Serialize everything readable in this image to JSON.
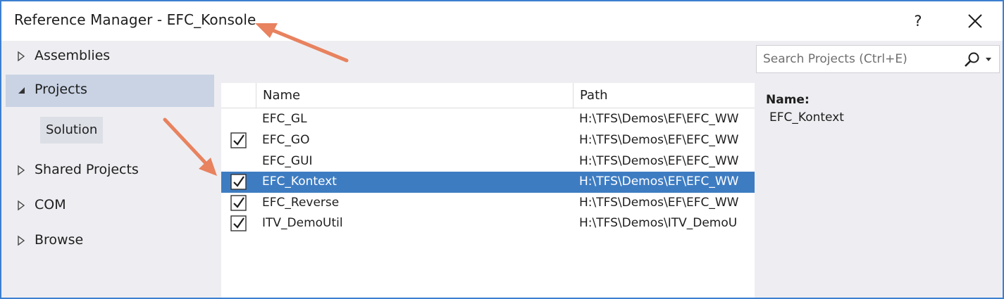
{
  "window": {
    "title": "Reference Manager - EFC_Konsole",
    "help_label": "?",
    "close_icon": "close-icon",
    "border_color": "#3c7fd0"
  },
  "nav": {
    "items": [
      {
        "label": "Assemblies",
        "expanded": false
      },
      {
        "label": "Projects",
        "expanded": true,
        "selected": true
      },
      {
        "label": "Shared Projects",
        "expanded": false
      },
      {
        "label": "COM",
        "expanded": false
      },
      {
        "label": "Browse",
        "expanded": false
      }
    ],
    "sub_item": "Solution"
  },
  "list": {
    "columns": {
      "name": "Name",
      "path": "Path"
    },
    "rows": [
      {
        "name": "EFC_GL",
        "path": "H:\\TFS\\Demos\\EF\\EFC_WW",
        "checked": false,
        "selected": false
      },
      {
        "name": "EFC_GO",
        "path": "H:\\TFS\\Demos\\EF\\EFC_WW",
        "checked": true,
        "selected": false
      },
      {
        "name": "EFC_GUI",
        "path": "H:\\TFS\\Demos\\EF\\EFC_WW",
        "checked": false,
        "selected": false
      },
      {
        "name": "EFC_Kontext",
        "path": "H:\\TFS\\Demos\\EF\\EFC_WW",
        "checked": true,
        "selected": true
      },
      {
        "name": "EFC_Reverse",
        "path": "H:\\TFS\\Demos\\EF\\EFC_WW",
        "checked": true,
        "selected": false
      },
      {
        "name": "ITV_DemoUtil",
        "path": "H:\\TFS\\Demos\\ITV_DemoU",
        "checked": true,
        "selected": false
      }
    ],
    "selected_color": "#3e7cc2"
  },
  "search": {
    "placeholder": "Search Projects (Ctrl+E)",
    "value": ""
  },
  "details": {
    "name_label": "Name:",
    "name_value": "EFC_Kontext"
  },
  "annotation": {
    "arrow_color": "#e8825f"
  }
}
